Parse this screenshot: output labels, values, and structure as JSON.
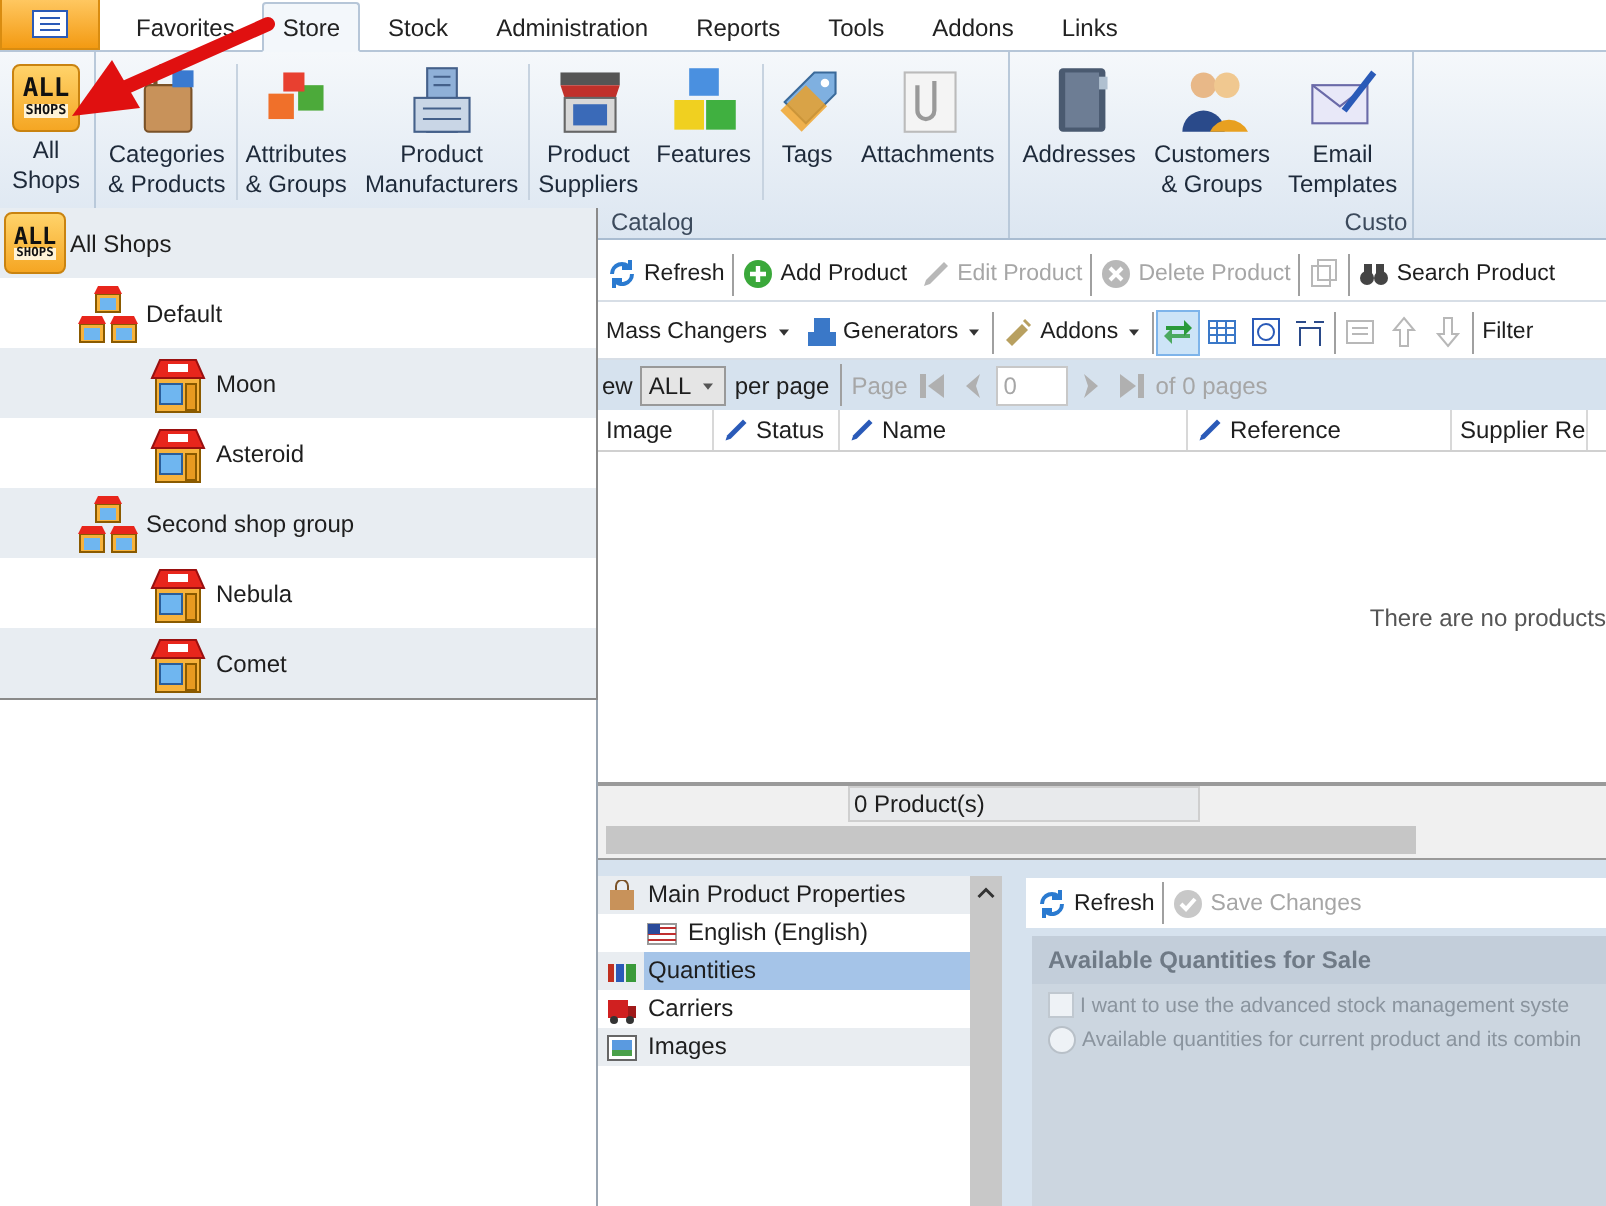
{
  "tabs": [
    {
      "label": "Favorites",
      "selected": false
    },
    {
      "label": "Store",
      "selected": true
    },
    {
      "label": "Stock",
      "selected": false
    },
    {
      "label": "Administration",
      "selected": false
    },
    {
      "label": "Reports",
      "selected": false
    },
    {
      "label": "Tools",
      "selected": false
    },
    {
      "label": "Addons",
      "selected": false
    },
    {
      "label": "Links",
      "selected": false
    }
  ],
  "ribbon": {
    "groups": [
      {
        "buttons": [
          {
            "lines": [
              "All",
              "Shops"
            ],
            "icon_text": [
              "ALL",
              "SHOPS"
            ]
          }
        ]
      },
      {
        "label": "Catalog",
        "buttons": [
          {
            "lines": [
              "Categories",
              "& Products"
            ]
          },
          {
            "lines": [
              "Attributes",
              "& Groups"
            ]
          },
          {
            "lines": [
              "Product",
              "Manufacturers"
            ]
          },
          {
            "lines": [
              "Product",
              "Suppliers"
            ]
          },
          {
            "lines": [
              "Features"
            ]
          },
          {
            "lines": [
              "Tags"
            ]
          },
          {
            "lines": [
              "Attachments"
            ]
          }
        ]
      },
      {
        "label": "Custo",
        "buttons": [
          {
            "lines": [
              "Addresses"
            ]
          },
          {
            "lines": [
              "Customers",
              "& Groups"
            ]
          },
          {
            "lines": [
              "Email",
              "Templates"
            ]
          }
        ]
      }
    ]
  },
  "shop_selector": {
    "items": [
      {
        "label": "All Shops",
        "kind": "all",
        "icon_text": [
          "ALL",
          "SHOPS"
        ],
        "children": [
          {
            "label": "Default",
            "kind": "group",
            "children": [
              {
                "label": "Moon",
                "kind": "shop"
              },
              {
                "label": "Asteroid",
                "kind": "shop"
              }
            ]
          },
          {
            "label": "Second shop group",
            "kind": "group",
            "children": [
              {
                "label": "Nebula",
                "kind": "shop"
              },
              {
                "label": "Comet",
                "kind": "shop"
              }
            ]
          }
        ]
      }
    ]
  },
  "toolbar": {
    "groups": [
      [
        {
          "kind": "button",
          "label": "Refresh",
          "disabled": false
        }
      ],
      [
        {
          "kind": "button",
          "label": "Add Product",
          "disabled": false
        },
        {
          "kind": "button",
          "label": "Edit Product",
          "disabled": true
        }
      ],
      [
        {
          "kind": "button",
          "label": "Delete Product",
          "disabled": true
        }
      ],
      [
        {
          "kind": "icon",
          "disabled": true
        }
      ],
      [
        {
          "kind": "button",
          "label": "Search Product",
          "disabled": false
        }
      ]
    ]
  },
  "toolbar_2": {
    "groups": [
      [
        {
          "kind": "button",
          "label": "Mass Changers",
          "dropdown": true,
          "disabled": false
        },
        {
          "kind": "button",
          "label": "Generators",
          "dropdown": true,
          "disabled": false
        }
      ],
      [
        {
          "kind": "button",
          "label": "Addons",
          "dropdown": true,
          "disabled": false
        }
      ],
      [
        {
          "kind": "icon",
          "selected": true,
          "disabled": false
        },
        {
          "kind": "icon",
          "selected": false,
          "disabled": false
        },
        {
          "kind": "icon",
          "selected": false,
          "disabled": false
        },
        {
          "kind": "icon",
          "selected": false,
          "disabled": false
        }
      ],
      [
        {
          "kind": "icon",
          "disabled": true
        },
        {
          "kind": "icon",
          "disabled": true
        },
        {
          "kind": "icon",
          "disabled": true
        }
      ],
      [
        {
          "kind": "button",
          "label": "Filter",
          "dropdown": false,
          "disabled": false
        }
      ]
    ]
  },
  "pager": {
    "view_label": "ew",
    "per_page_value": "ALL",
    "per_page_label": "per page",
    "page_label": "Page",
    "page_value": "0",
    "of_pages": "of 0 pages",
    "disabled": true
  },
  "table": {
    "columns": [
      {
        "label": "Image",
        "editable": false
      },
      {
        "label": "Status",
        "editable": true
      },
      {
        "label": "Name",
        "editable": true
      },
      {
        "label": "Reference",
        "editable": true
      },
      {
        "label": "Supplier Re",
        "editable": false
      }
    ],
    "empty_message": "There are no products"
  },
  "status_bar": {
    "count": "0 Product(s)"
  },
  "details": {
    "nav": [
      {
        "label": "Main Product Properties",
        "selected": false,
        "children": [
          {
            "label": "English (English)",
            "selected": false
          }
        ]
      },
      {
        "label": "Quantities",
        "selected": true
      },
      {
        "label": "Carriers",
        "selected": false
      },
      {
        "label": "Images",
        "selected": false
      }
    ],
    "toolbar": [
      {
        "label": "Refresh",
        "disabled": false
      },
      {
        "label": "Save Changes",
        "disabled": true
      }
    ],
    "section": {
      "title": "Available Quantities for Sale",
      "disabled": true,
      "options": [
        {
          "kind": "checkbox",
          "label": "I want to use the advanced stock management syste",
          "checked": false
        },
        {
          "kind": "radio",
          "label": "Available quantities for current product and its combin",
          "selected": false
        }
      ]
    }
  }
}
